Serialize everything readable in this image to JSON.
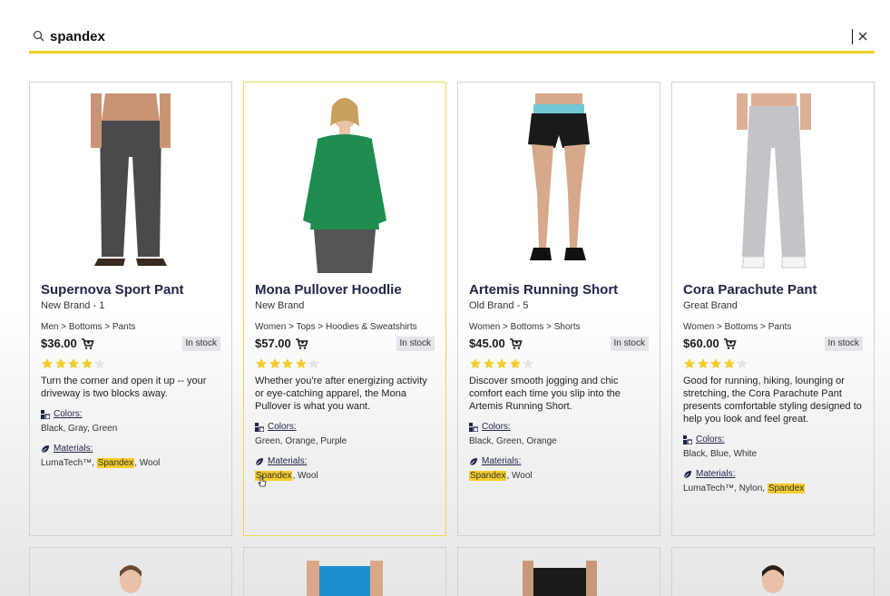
{
  "search": {
    "query": "spandex"
  },
  "products": [
    {
      "name": "Supernova Sport Pant",
      "brand": "New Brand - 1",
      "breadcrumb": "Men > Bottoms > Pants",
      "price": "$36.00",
      "stock": "In stock",
      "rating": 4,
      "description": "Turn the corner and open it up -- your driveway is two blocks away.",
      "colors_label": "Colors:",
      "colors": "Black, Gray, Green",
      "materials_label": "Materials:",
      "materials": [
        {
          "text": "LumaTech™, ",
          "hl": false
        },
        {
          "text": "Spandex",
          "hl": true
        },
        {
          "text": ", Wool",
          "hl": false
        }
      ]
    },
    {
      "name": "Mona Pullover Hoodlie",
      "brand": "New Brand",
      "breadcrumb": "Women > Tops > Hoodies & Sweatshirts",
      "price": "$57.00",
      "stock": "In stock",
      "rating": 4,
      "description": "Whether you're after energizing activity or eye-catching apparel, the Mona Pullover is what you want.",
      "colors_label": "Colors:",
      "colors": "Green, Orange, Purple",
      "materials_label": "Materials:",
      "materials": [
        {
          "text": "Spandex",
          "hl": true
        },
        {
          "text": ", Wool",
          "hl": false
        }
      ]
    },
    {
      "name": "Artemis Running Short",
      "brand": "Old Brand - 5",
      "breadcrumb": "Women > Bottoms > Shorts",
      "price": "$45.00",
      "stock": "In stock",
      "rating": 4,
      "description": "Discover smooth jogging and chic comfort each time you slip into the Artemis Running Short.",
      "colors_label": "Colors:",
      "colors": "Black, Green, Orange",
      "materials_label": "Materials:",
      "materials": [
        {
          "text": "Spandex",
          "hl": true
        },
        {
          "text": ", Wool",
          "hl": false
        }
      ]
    },
    {
      "name": "Cora Parachute Pant",
      "brand": "Great Brand",
      "breadcrumb": "Women > Bottoms > Pants",
      "price": "$60.00",
      "stock": "In stock",
      "rating": 4,
      "description": "Good for running, hiking, lounging or stretching, the Cora Parachute Pant presents comfortable styling designed to help you look and feel great.",
      "colors_label": "Colors:",
      "colors": "Black, Blue, White",
      "materials_label": "Materials:",
      "materials": [
        {
          "text": "LumaTech™, Nylon, ",
          "hl": false
        },
        {
          "text": "Spandex",
          "hl": true
        }
      ]
    }
  ],
  "colors": {
    "accent": "#f3cd2b",
    "title": "#22264a",
    "border": "#cfd3d8"
  }
}
